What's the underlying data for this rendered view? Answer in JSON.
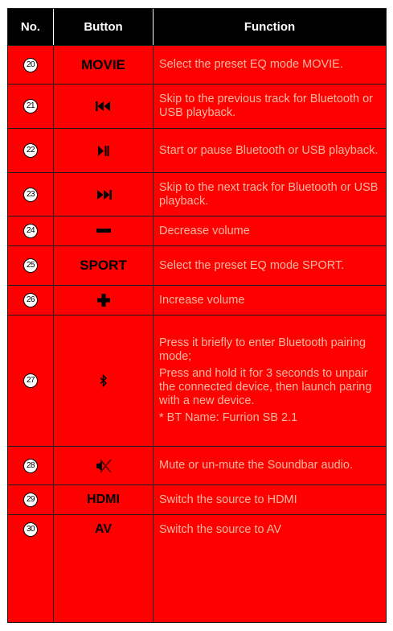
{
  "header": {
    "no": "No.",
    "button": "Button",
    "function": "Function"
  },
  "rows": [
    {
      "no": "20",
      "button_label": "MOVIE",
      "icon": "",
      "function": [
        "Select the preset EQ mode MOVIE."
      ]
    },
    {
      "no": "21",
      "button_label": "",
      "icon": "previous-track-icon",
      "function": [
        "Skip to the previous track for Bluetooth or USB playback."
      ]
    },
    {
      "no": "22",
      "button_label": "",
      "icon": "play-pause-icon",
      "function": [
        "Start or pause Bluetooth or USB playback."
      ]
    },
    {
      "no": "23",
      "button_label": "",
      "icon": "next-track-icon",
      "function": [
        "Skip to the next track for Bluetooth or USB playback."
      ]
    },
    {
      "no": "24",
      "button_label": "",
      "icon": "minus-icon",
      "function": [
        "Decrease volume"
      ]
    },
    {
      "no": "25",
      "button_label": "SPORT",
      "icon": "",
      "function": [
        "Select the preset EQ mode SPORT."
      ]
    },
    {
      "no": "26",
      "button_label": "",
      "icon": "plus-icon",
      "function": [
        "Increase volume"
      ]
    },
    {
      "no": "27",
      "button_label": "",
      "icon": "bluetooth-icon",
      "function": [
        "Press it briefly to enter Bluetooth pairing mode;",
        "Press and hold it for 3 seconds to unpair the connected device, then launch paring with a new device.",
        "* BT Name: Furrion SB 2.1"
      ]
    },
    {
      "no": "28",
      "button_label": "",
      "icon": "mute-icon",
      "function": [
        "Mute or un-mute the Soundbar audio."
      ]
    },
    {
      "no": "29",
      "button_label": "HDMI",
      "icon": "",
      "function": [
        "Switch the source to HDMI"
      ]
    },
    {
      "no": "30",
      "button_label": "AV",
      "icon": "",
      "function": [
        "Switch the source to AV"
      ]
    }
  ],
  "colors": {
    "row_background": "#ff0000",
    "header_background": "#000000",
    "function_text": "#f7b8a3"
  }
}
